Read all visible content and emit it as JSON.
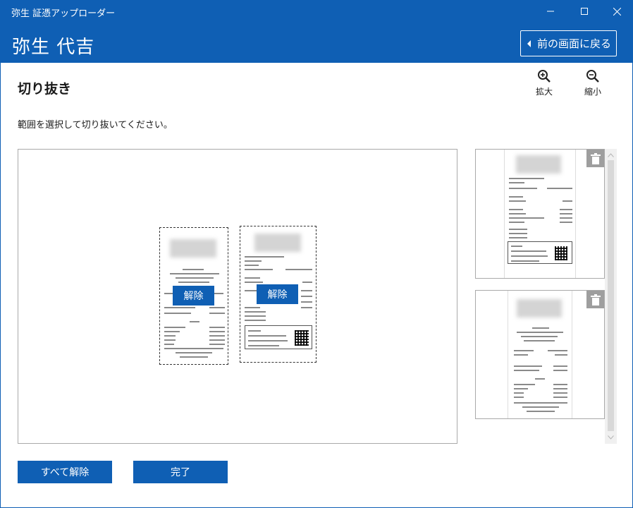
{
  "window": {
    "app_title": "弥生 証憑アップローダー",
    "minimize_glyph": "—",
    "maximize_glyph": "☐",
    "close_glyph": "✕"
  },
  "header": {
    "company_name": "弥生 代吉",
    "back_button_label": "前の画面に戻る"
  },
  "page": {
    "title": "切り抜き",
    "instruction": "範囲を選択して切り抜いてください。"
  },
  "toolbar": {
    "zoom_in_label": "拡大",
    "zoom_out_label": "縮小"
  },
  "canvas": {
    "crops": [
      {
        "release_label": "解除"
      },
      {
        "release_label": "解除"
      }
    ]
  },
  "thumbnails": {
    "items": [
      {
        "icon": "trash-icon"
      },
      {
        "icon": "trash-icon"
      }
    ]
  },
  "footer": {
    "release_all_label": "すべて解除",
    "done_label": "完了"
  },
  "colors": {
    "brand": "#0f5fb4",
    "trash_bg": "#9e9e9e"
  }
}
